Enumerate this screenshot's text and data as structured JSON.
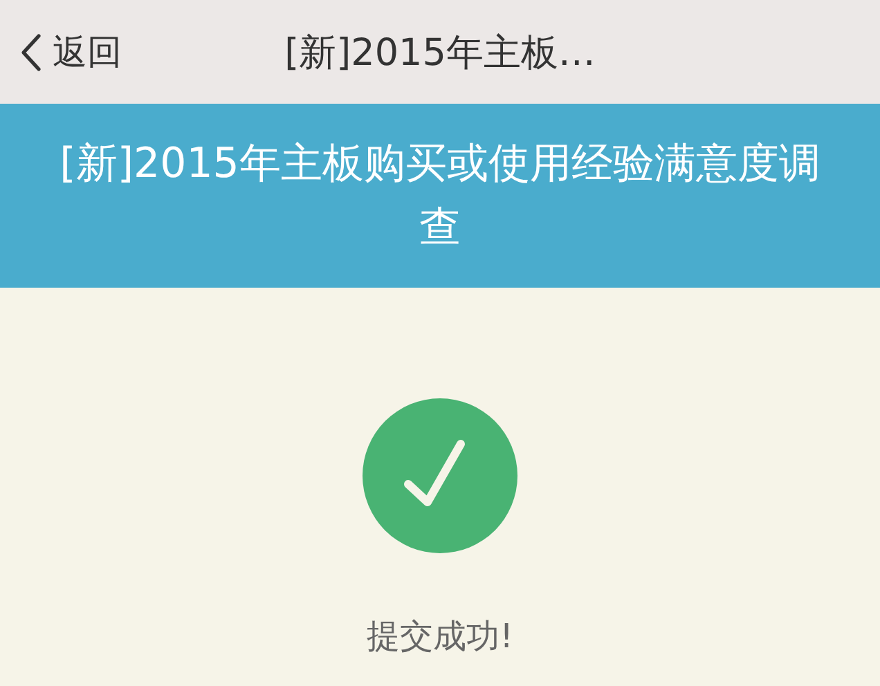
{
  "nav_bar": {
    "back_label": "返回",
    "title": "[新]2015年主板…"
  },
  "banner": {
    "title": "[新]2015年主板购买或使用经验满意度调查"
  },
  "result": {
    "success": true,
    "message": "提交成功!"
  }
}
